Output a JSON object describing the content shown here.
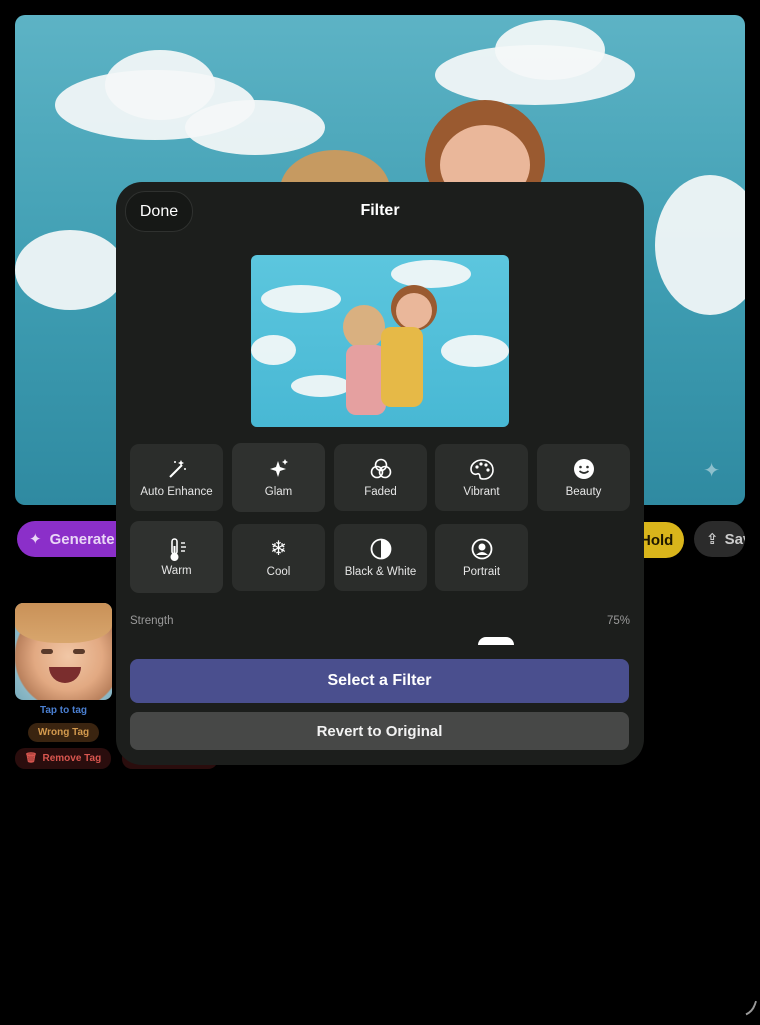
{
  "background": {
    "generate_label": "Generate A",
    "hold_label": "Hold",
    "save_label": "Sav"
  },
  "face_card": {
    "tap_to_tag": "Tap to tag",
    "wrong_tag": "Wrong Tag",
    "remove_tag": "Remove Tag"
  },
  "sheet": {
    "done_label": "Done",
    "title": "Filter",
    "filters": [
      {
        "label": "Auto Enhance",
        "icon": "magic-wand-icon"
      },
      {
        "label": "Glam",
        "icon": "sparkles-icon"
      },
      {
        "label": "Faded",
        "icon": "overlapping-circles-icon"
      },
      {
        "label": "Vibrant",
        "icon": "palette-icon"
      },
      {
        "label": "Beauty",
        "icon": "smiley-face-icon"
      },
      {
        "label": "Warm",
        "icon": "thermometer-sun-icon"
      },
      {
        "label": "Cool",
        "icon": "snowflake-icon"
      },
      {
        "label": "Black & White",
        "icon": "half-circle-icon"
      },
      {
        "label": "Portrait",
        "icon": "person-circle-icon"
      }
    ],
    "strength_label": "Strength",
    "strength_value": "75%",
    "select_filter_label": "Select a Filter",
    "revert_label": "Revert to Original"
  },
  "colors": {
    "primary_button": "#4a4f8e",
    "generate_pill": "#8b2fc9",
    "hold_pill": "#d9b51b"
  }
}
